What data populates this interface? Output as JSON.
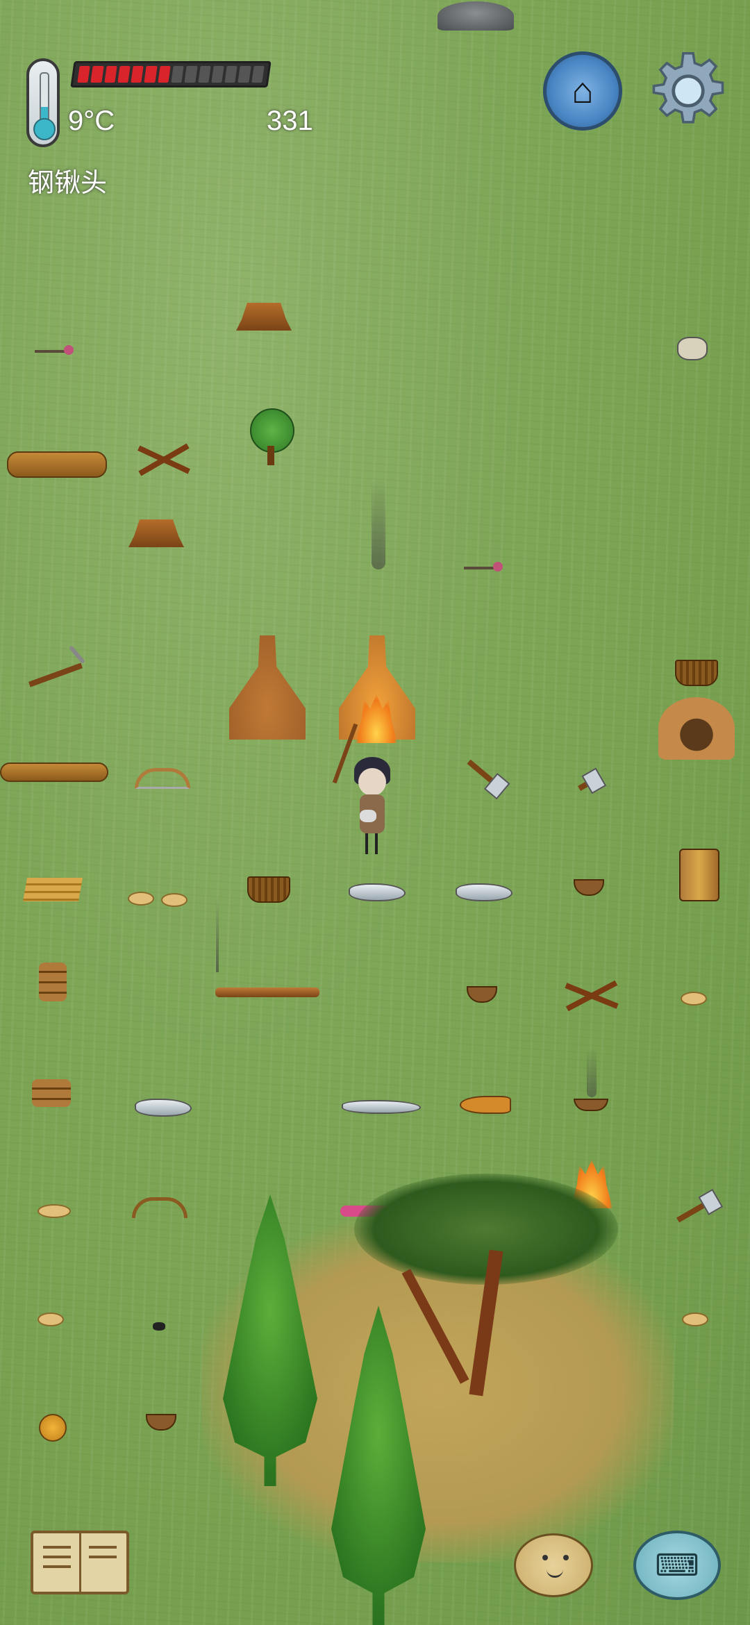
{
  "hud": {
    "temperature": "9°C",
    "food_pips_total": 14,
    "food_pips_filled": 7,
    "score": "331",
    "held_item": "钢锹头"
  },
  "colors": {
    "grass": "#7ea657",
    "food_filled": "#d8242a",
    "food_empty": "#555555",
    "thermometer": "#3bb7c9",
    "home_button": "#4a86c4",
    "dirt_patch": "#b39a52"
  },
  "icons": {
    "home": "⌂",
    "keyboard": "⌨",
    "settings": "gear-icon",
    "book": "book-icon",
    "emote": "smiley-face-icon"
  }
}
